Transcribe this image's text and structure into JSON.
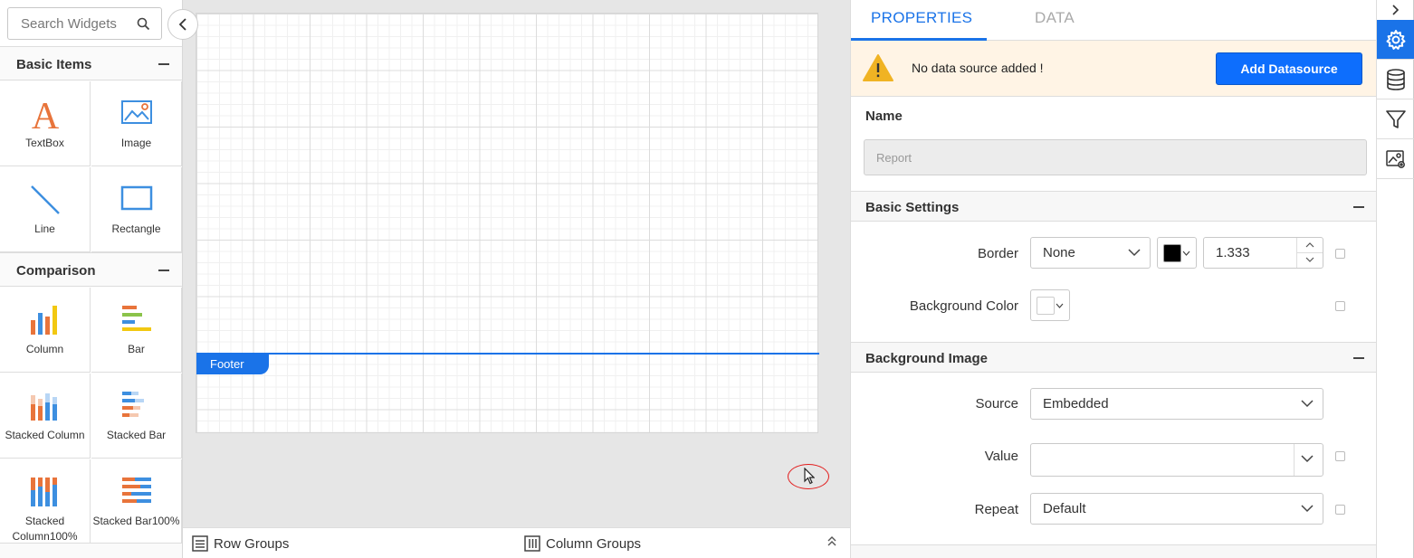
{
  "search": {
    "placeholder": "Search Widgets"
  },
  "categories": [
    {
      "label": "Basic Items",
      "items": [
        "TextBox",
        "Image",
        "Line",
        "Rectangle"
      ]
    },
    {
      "label": "Comparison",
      "items": [
        "Column",
        "Bar",
        "Stacked Column",
        "Stacked Bar",
        "Stacked Column100%",
        "Stacked Bar100%"
      ]
    }
  ],
  "canvas": {
    "footer_label": "Footer"
  },
  "bottom": {
    "row_groups": "Row Groups",
    "column_groups": "Column Groups"
  },
  "tabs": {
    "properties": "PROPERTIES",
    "data": "DATA"
  },
  "warning": {
    "message": "No data source added !",
    "button": "Add Datasource"
  },
  "name": {
    "label": "Name",
    "value": "Report"
  },
  "basic_settings": {
    "title": "Basic Settings",
    "border_label": "Border",
    "border_value": "None",
    "border_color": "#000000",
    "border_width": "1.333",
    "bg_color_label": "Background Color",
    "bg_color": "#ffffff"
  },
  "background_image": {
    "title": "Background Image",
    "source_label": "Source",
    "source_value": "Embedded",
    "value_label": "Value",
    "value_value": "",
    "repeat_label": "Repeat",
    "repeat_value": "Default"
  },
  "colors": {
    "accent": "#1a73e8",
    "warning_bg": "#fff4e5",
    "warning_icon": "#f0b323"
  }
}
